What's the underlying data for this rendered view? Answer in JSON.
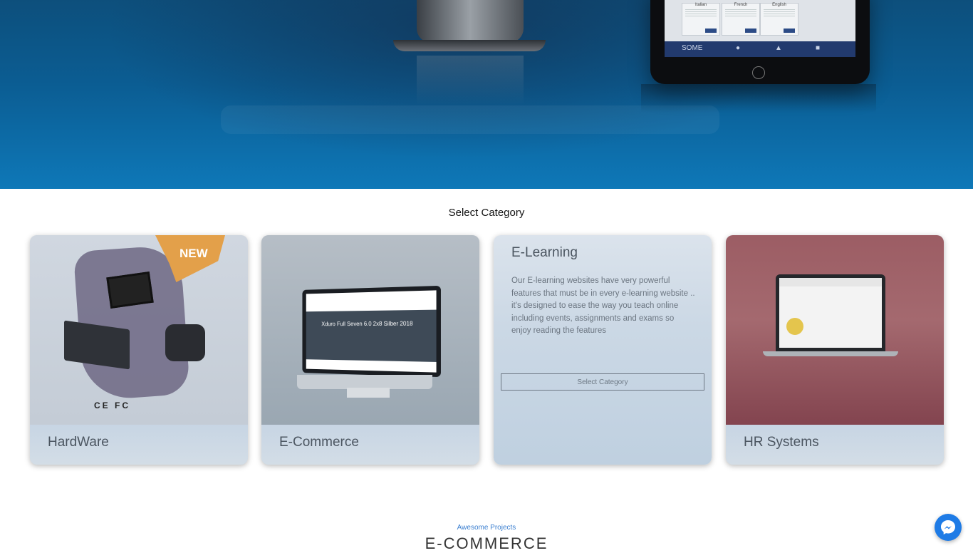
{
  "hero": {
    "tablet_nav_label": "SOME",
    "tablet_cards": [
      {
        "title": "Italian"
      },
      {
        "title": "French"
      },
      {
        "title": "English"
      }
    ]
  },
  "categories_section": {
    "title": "Select Category",
    "cards": [
      {
        "label": "HardWare",
        "badge": "NEW",
        "cert_marks": "CE FC"
      },
      {
        "label": "E-Commerce",
        "screen_text": "Xduro Full Seven 6.0 2x8 Silber 2018"
      },
      {
        "label": "E-Learning",
        "description": "Our E-learning websites have very powerful features that must be in every e-learning website .. it's designed to ease the way you teach online including events, assignments and exams so enjoy reading the features",
        "button_label": "Select Category"
      },
      {
        "label": "HR Systems"
      }
    ]
  },
  "projects": {
    "label": "Awesome Projects",
    "heading": "E-COMMERCE"
  },
  "icons": {
    "messenger": "messenger-icon"
  },
  "colors": {
    "hero_blue": "#0b5d93",
    "accent_link": "#3b7fd0",
    "messenger_blue": "#1e7be6",
    "new_badge": "#e3a04a"
  }
}
